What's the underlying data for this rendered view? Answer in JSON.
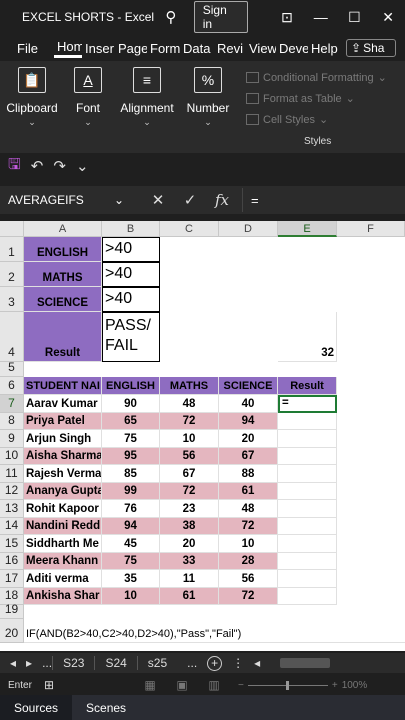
{
  "window": {
    "title": "EXCEL SHORTS - Excel",
    "signin": "Sign in",
    "controls": [
      "⊡",
      "—",
      "☐",
      "✕"
    ]
  },
  "tabs": [
    "File",
    "Hom",
    "Inser",
    "Page",
    "Form",
    "Data",
    "Revi",
    "View",
    "Deve",
    "Help"
  ],
  "share_label": "Sha",
  "ribbon": {
    "clipboard": "Clipboard",
    "font": "Font",
    "alignment": "Alignment",
    "number": "Number",
    "conditional_formatting": "Conditional Formatting",
    "format_as_table": "Format as Table",
    "cell_styles": "Cell Styles",
    "styles_label": "Styles"
  },
  "namebox": "AVERAGEIFS",
  "formula": "=",
  "columns": [
    "A",
    "B",
    "C",
    "D",
    "E",
    "F"
  ],
  "criteria": [
    {
      "row": "1",
      "subject": "ENGLISH",
      "value": ">40"
    },
    {
      "row": "2",
      "subject": "MATHS",
      "value": ">40"
    },
    {
      "row": "3",
      "subject": "SCIENCE",
      "value": ">40"
    },
    {
      "row": "4",
      "subject": "Result",
      "value": "PASS/ FAIL",
      "extra": "32"
    }
  ],
  "table_header": {
    "row": "6",
    "name": "STUDENT NAI",
    "english": "ENGLISH",
    "maths": "MATHS",
    "science": "SCIENCE",
    "result": "Result"
  },
  "students": [
    {
      "row": "7",
      "name": "Aarav Kumar",
      "english": "90",
      "maths": "48",
      "science": "40",
      "result": "="
    },
    {
      "row": "8",
      "name": "Priya Patel",
      "english": "65",
      "maths": "72",
      "science": "94",
      "result": ""
    },
    {
      "row": "9",
      "name": "Arjun Singh",
      "english": "75",
      "maths": "10",
      "science": "20",
      "result": ""
    },
    {
      "row": "10",
      "name": "Aisha Sharma",
      "english": "95",
      "maths": "56",
      "science": "67",
      "result": ""
    },
    {
      "row": "11",
      "name": "Rajesh Verma",
      "english": "85",
      "maths": "67",
      "science": "88",
      "result": ""
    },
    {
      "row": "12",
      "name": "Ananya Gupta",
      "english": "99",
      "maths": "72",
      "science": "61",
      "result": ""
    },
    {
      "row": "13",
      "name": "Rohit Kapoor",
      "english": "76",
      "maths": "23",
      "science": "48",
      "result": ""
    },
    {
      "row": "14",
      "name": "Nandini Redd",
      "english": "94",
      "maths": "38",
      "science": "72",
      "result": ""
    },
    {
      "row": "15",
      "name": "Siddharth Me",
      "english": "45",
      "maths": "20",
      "science": "10",
      "result": ""
    },
    {
      "row": "16",
      "name": "Meera Khann",
      "english": "75",
      "maths": "33",
      "science": "28",
      "result": ""
    },
    {
      "row": "17",
      "name": "Aditi verma",
      "english": "35",
      "maths": "11",
      "science": "56",
      "result": ""
    },
    {
      "row": "18",
      "name": "Ankisha Shar",
      "english": "10",
      "maths": "61",
      "science": "72",
      "result": ""
    }
  ],
  "empty_rows": [
    "5",
    "19"
  ],
  "note_row": "20",
  "note": "IF(AND(B2>40,C2>40,D2>40),\"Pass\",\"Fail\")",
  "sheets": [
    "S23",
    "S24",
    "s25"
  ],
  "status_mode": "Enter",
  "zoom": "100%",
  "obs": [
    "Sources",
    "Scenes"
  ]
}
